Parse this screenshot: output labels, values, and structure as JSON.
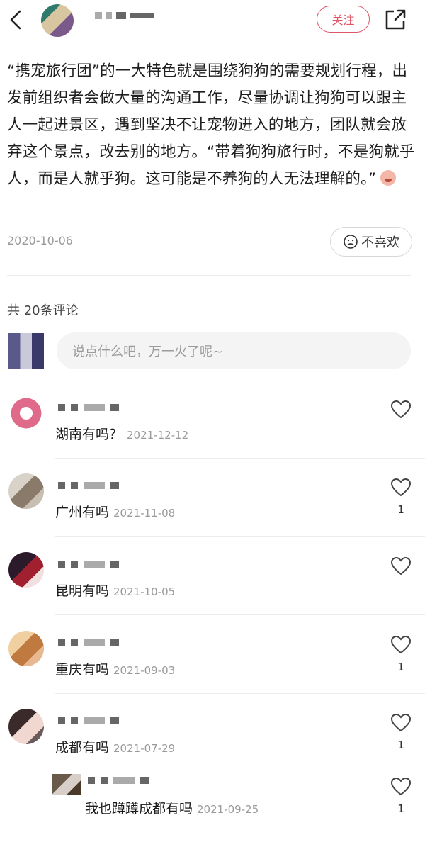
{
  "header": {
    "follow_label": "关注"
  },
  "post": {
    "text": "“携宠旅行团”的一大特色就是围绕狗狗的需要规划行程，出发前组织者会做大量的沟通工作，尽量协调让狗狗可以跟主人一起进景区，遇到坚决不让宠物进入的地方，团队就会放弃这个景点，改去别的地方。“带着狗狗旅行时，不是狗就乎人，而是人就乎狗。这可能是不养狗的人无法理解的。”",
    "date": "2020-10-06",
    "dislike_label": "不喜欢"
  },
  "comments_section": {
    "count_label": "共 20条评论",
    "input_placeholder": "说点什么吧，万一火了呢~"
  },
  "comments": [
    {
      "text": "湖南有吗？",
      "time": "2021-12-12",
      "likes": ""
    },
    {
      "text": "广州有吗",
      "time": "2021-11-08",
      "likes": "1"
    },
    {
      "text": "昆明有吗",
      "time": "2021-10-05",
      "likes": ""
    },
    {
      "text": "重庆有吗",
      "time": "2021-09-03",
      "likes": "1"
    },
    {
      "text": "成都有吗",
      "time": "2021-07-29",
      "likes": "1"
    },
    {
      "text": "我也蹲蹲成都有吗",
      "time": "2021-09-25",
      "likes": "1"
    }
  ],
  "colors": {
    "accent": "#e05566"
  },
  "icons": [
    "back-icon",
    "share-icon",
    "sad-face-icon",
    "heart-icon"
  ]
}
